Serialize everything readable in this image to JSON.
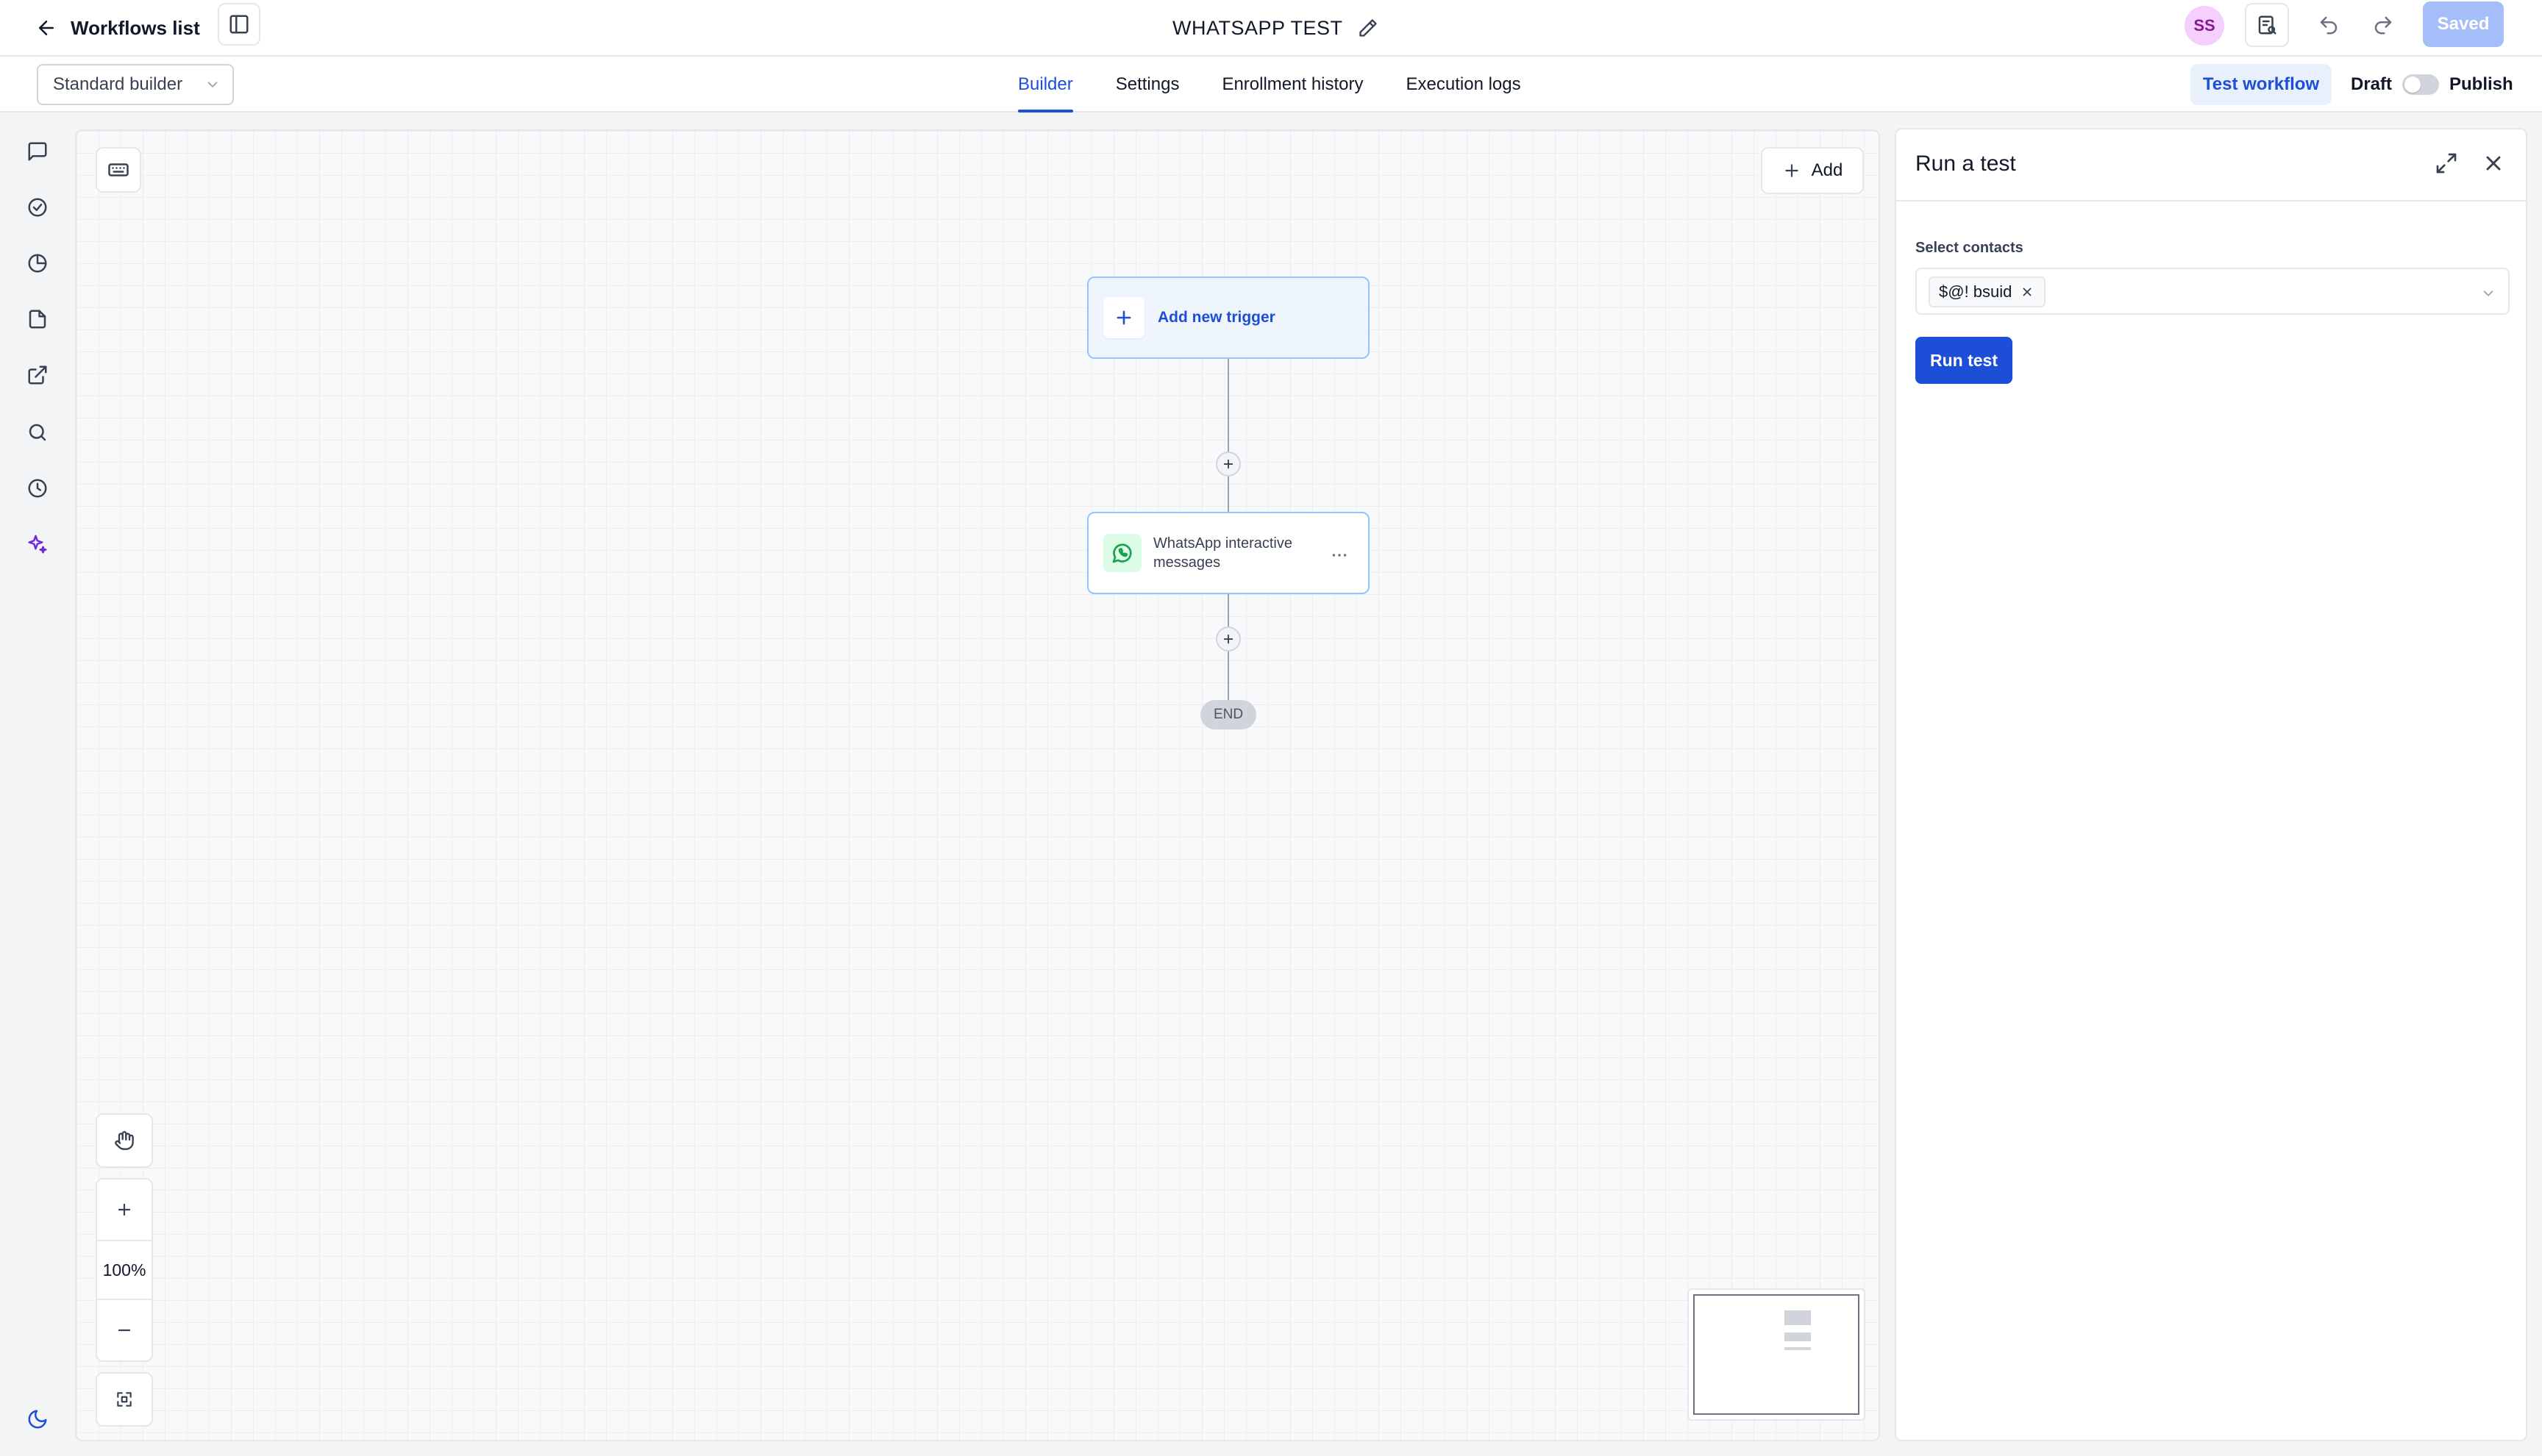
{
  "header": {
    "back_label": "Workflows list",
    "workflow_title": "WHATSAPP TEST",
    "avatar_initials": "SS",
    "saved_label": "Saved"
  },
  "subheader": {
    "builder_mode": "Standard builder",
    "tabs": [
      {
        "label": "Builder",
        "active": true
      },
      {
        "label": "Settings",
        "active": false
      },
      {
        "label": "Enrollment history",
        "active": false
      },
      {
        "label": "Execution logs",
        "active": false
      }
    ],
    "test_workflow_label": "Test workflow",
    "draft_label": "Draft",
    "publish_label": "Publish"
  },
  "left_rail": {
    "icons": [
      "message-icon",
      "check-circle-icon",
      "pie-chart-icon",
      "file-icon",
      "external-link-icon",
      "search-icon",
      "clock-icon",
      "sparkles-icon",
      "moon-icon"
    ]
  },
  "canvas": {
    "add_label": "Add",
    "trigger_label": "Add new trigger",
    "action_node_label": "WhatsApp interactive messages",
    "end_label": "END",
    "zoom_level": "100%"
  },
  "test_panel": {
    "title": "Run a test",
    "field_label": "Select contacts",
    "selected_contact": "$@! bsuid",
    "run_label": "Run test"
  },
  "colors": {
    "accent": "#1d4ed8",
    "saved_disabled": "#a5bdf8",
    "test_workflow_bg": "#e8f0fc",
    "whatsapp_green": "#16a34a"
  }
}
